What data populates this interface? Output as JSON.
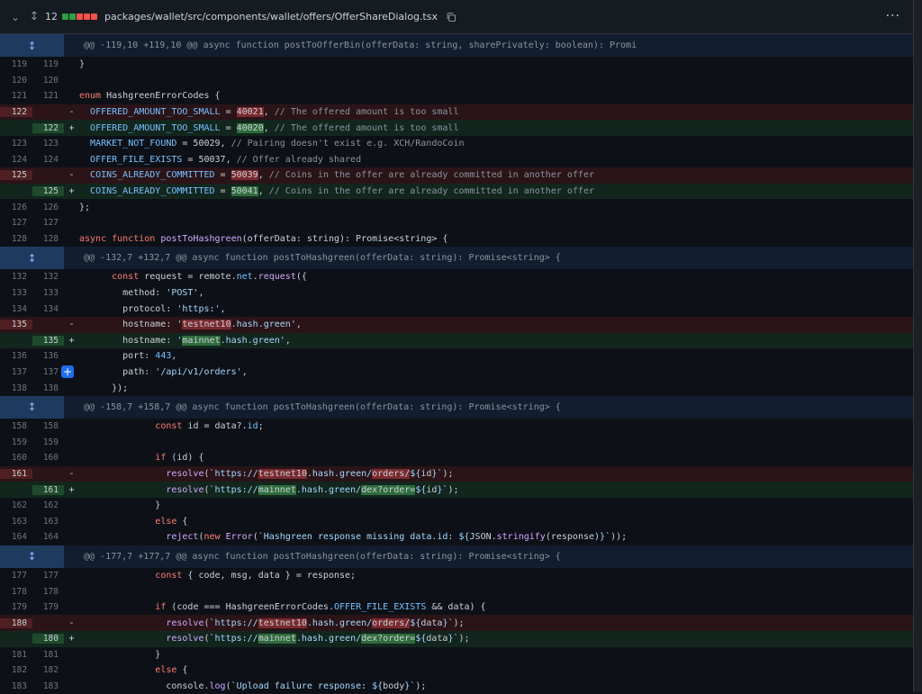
{
  "file": {
    "change_count": "12",
    "path": "packages/wallet/src/components/wallet/offers/OfferShareDialog.tsx",
    "diffstat_colors": [
      "#2ea043",
      "#2ea043",
      "#f85149",
      "#f85149",
      "#f85149"
    ],
    "icons": {
      "collapse": "chevron-down-icon",
      "expand": "expand-icon",
      "copy": "copy-icon",
      "more": "kebab-icon"
    }
  },
  "rows": [
    {
      "type": "hunk",
      "text": "@@ -119,10 +119,10 @@ async function postToOfferBin(offerData: string, sharePrivately: boolean): Promi"
    },
    {
      "type": "ctx",
      "old": "119",
      "new": "119",
      "tokens": [
        [
          "p",
          "}"
        ]
      ]
    },
    {
      "type": "ctx",
      "old": "120",
      "new": "120",
      "tokens": []
    },
    {
      "type": "ctx",
      "old": "121",
      "new": "121",
      "tokens": [
        [
          "kw",
          "enum "
        ],
        [
          "p",
          "HashgreenErrorCodes {"
        ]
      ]
    },
    {
      "type": "del",
      "old": "122",
      "new": "",
      "tokens": [
        [
          "p",
          "  "
        ],
        [
          "c",
          "OFFERED_AMOUNT_TOO_SMALL"
        ],
        [
          "p",
          " = "
        ],
        [
          "hd",
          "40021"
        ],
        [
          "p",
          ", "
        ],
        [
          "com",
          "// The offered amount is too small"
        ]
      ]
    },
    {
      "type": "add",
      "old": "",
      "new": "122",
      "tokens": [
        [
          "p",
          "  "
        ],
        [
          "c",
          "OFFERED_AMOUNT_TOO_SMALL"
        ],
        [
          "p",
          " = "
        ],
        [
          "ha",
          "40020"
        ],
        [
          "p",
          ", "
        ],
        [
          "com",
          "// The offered amount is too small"
        ]
      ]
    },
    {
      "type": "ctx",
      "old": "123",
      "new": "123",
      "tokens": [
        [
          "p",
          "  "
        ],
        [
          "c",
          "MARKET_NOT_FOUND"
        ],
        [
          "p",
          " = 50029, "
        ],
        [
          "com",
          "// Pairing doesn't exist e.g. XCH/RandoCoin"
        ]
      ]
    },
    {
      "type": "ctx",
      "old": "124",
      "new": "124",
      "tokens": [
        [
          "p",
          "  "
        ],
        [
          "c",
          "OFFER_FILE_EXISTS"
        ],
        [
          "p",
          " = 50037, "
        ],
        [
          "com",
          "// Offer already shared"
        ]
      ]
    },
    {
      "type": "del",
      "old": "125",
      "new": "",
      "tokens": [
        [
          "p",
          "  "
        ],
        [
          "c",
          "COINS_ALREADY_COMMITTED"
        ],
        [
          "p",
          " = "
        ],
        [
          "hd",
          "50039"
        ],
        [
          "p",
          ", "
        ],
        [
          "com",
          "// Coins in the offer are already committed in another offer"
        ]
      ]
    },
    {
      "type": "add",
      "old": "",
      "new": "125",
      "tokens": [
        [
          "p",
          "  "
        ],
        [
          "c",
          "COINS_ALREADY_COMMITTED"
        ],
        [
          "p",
          " = "
        ],
        [
          "ha",
          "50041"
        ],
        [
          "p",
          ", "
        ],
        [
          "com",
          "// Coins in the offer are already committed in another offer"
        ]
      ]
    },
    {
      "type": "ctx",
      "old": "126",
      "new": "126",
      "tokens": [
        [
          "p",
          "};"
        ]
      ]
    },
    {
      "type": "ctx",
      "old": "127",
      "new": "127",
      "tokens": []
    },
    {
      "type": "ctx",
      "old": "128",
      "new": "128",
      "tokens": [
        [
          "kw",
          "async function "
        ],
        [
          "fn",
          "postToHashgreen"
        ],
        [
          "p",
          "(offerData: string): Promise<string> {"
        ]
      ]
    },
    {
      "type": "hunk",
      "text": "@@ -132,7 +132,7 @@ async function postToHashgreen(offerData: string): Promise<string> {"
    },
    {
      "type": "ctx",
      "old": "132",
      "new": "132",
      "tokens": [
        [
          "p",
          "      "
        ],
        [
          "kw",
          "const "
        ],
        [
          "p",
          "request = remote."
        ],
        [
          "c",
          "net"
        ],
        [
          "p",
          "."
        ],
        [
          "fn",
          "request"
        ],
        [
          "p",
          "({"
        ]
      ]
    },
    {
      "type": "ctx",
      "old": "133",
      "new": "133",
      "tokens": [
        [
          "p",
          "        method: "
        ],
        [
          "s",
          "'POST'"
        ],
        [
          "p",
          ","
        ]
      ]
    },
    {
      "type": "ctx",
      "old": "134",
      "new": "134",
      "tokens": [
        [
          "p",
          "        protocol: "
        ],
        [
          "s",
          "'https:'"
        ],
        [
          "p",
          ","
        ]
      ]
    },
    {
      "type": "del",
      "old": "135",
      "new": "",
      "tokens": [
        [
          "p",
          "        hostname: "
        ],
        [
          "s",
          "'"
        ],
        [
          "hd",
          "testnet10"
        ],
        [
          "s",
          ".hash.green'"
        ],
        [
          "p",
          ","
        ]
      ]
    },
    {
      "type": "add",
      "old": "",
      "new": "135",
      "tokens": [
        [
          "p",
          "        hostname: "
        ],
        [
          "s",
          "'"
        ],
        [
          "ha",
          "mainnet"
        ],
        [
          "s",
          ".hash.green'"
        ],
        [
          "p",
          ","
        ]
      ]
    },
    {
      "type": "ctx",
      "old": "136",
      "new": "136",
      "tokens": [
        [
          "p",
          "        port: "
        ],
        [
          "n",
          "443"
        ],
        [
          "p",
          ","
        ]
      ]
    },
    {
      "type": "ctx",
      "old": "137",
      "new": "137",
      "plus": true,
      "tokens": [
        [
          "p",
          "        path: "
        ],
        [
          "s",
          "'/api/v1/orders'"
        ],
        [
          "p",
          ","
        ]
      ]
    },
    {
      "type": "ctx",
      "old": "138",
      "new": "138",
      "tokens": [
        [
          "p",
          "      });"
        ]
      ]
    },
    {
      "type": "hunk",
      "text": "@@ -158,7 +158,7 @@ async function postToHashgreen(offerData: string): Promise<string> {"
    },
    {
      "type": "ctx",
      "old": "158",
      "new": "158",
      "tokens": [
        [
          "p",
          "              "
        ],
        [
          "kw",
          "const "
        ],
        [
          "p",
          "id = data?."
        ],
        [
          "c",
          "id"
        ],
        [
          "p",
          ";"
        ]
      ]
    },
    {
      "type": "ctx",
      "old": "159",
      "new": "159",
      "tokens": []
    },
    {
      "type": "ctx",
      "old": "160",
      "new": "160",
      "tokens": [
        [
          "p",
          "              "
        ],
        [
          "kw",
          "if "
        ],
        [
          "p",
          "(id) {"
        ]
      ]
    },
    {
      "type": "del",
      "old": "161",
      "new": "",
      "tokens": [
        [
          "p",
          "                "
        ],
        [
          "fn",
          "resolve"
        ],
        [
          "p",
          "("
        ],
        [
          "s",
          "`https://"
        ],
        [
          "hd",
          "testnet10"
        ],
        [
          "s",
          ".hash.green/"
        ],
        [
          "hd",
          "orders/"
        ],
        [
          "s",
          "${"
        ],
        [
          "p",
          "id"
        ],
        [
          "s",
          "}`"
        ],
        [
          "p",
          ");"
        ]
      ]
    },
    {
      "type": "add",
      "old": "",
      "new": "161",
      "tokens": [
        [
          "p",
          "                "
        ],
        [
          "fn",
          "resolve"
        ],
        [
          "p",
          "("
        ],
        [
          "s",
          "`https://"
        ],
        [
          "ha",
          "mainnet"
        ],
        [
          "s",
          ".hash.green/"
        ],
        [
          "ha",
          "dex?order="
        ],
        [
          "s",
          "${"
        ],
        [
          "p",
          "id"
        ],
        [
          "s",
          "}`"
        ],
        [
          "p",
          ");"
        ]
      ]
    },
    {
      "type": "ctx",
      "old": "162",
      "new": "162",
      "tokens": [
        [
          "p",
          "              }"
        ]
      ]
    },
    {
      "type": "ctx",
      "old": "163",
      "new": "163",
      "tokens": [
        [
          "p",
          "              "
        ],
        [
          "kw",
          "else "
        ],
        [
          "p",
          "{"
        ]
      ]
    },
    {
      "type": "ctx",
      "old": "164",
      "new": "164",
      "tokens": [
        [
          "p",
          "                "
        ],
        [
          "fn",
          "reject"
        ],
        [
          "p",
          "("
        ],
        [
          "kw",
          "new "
        ],
        [
          "fn",
          "Error"
        ],
        [
          "p",
          "("
        ],
        [
          "s",
          "`Hashgreen response missing data.id: ${"
        ],
        [
          "p",
          "JSON."
        ],
        [
          "fn",
          "stringify"
        ],
        [
          "p",
          "(response)"
        ],
        [
          "s",
          "}`"
        ],
        [
          "p",
          "));"
        ]
      ]
    },
    {
      "type": "hunk",
      "text": "@@ -177,7 +177,7 @@ async function postToHashgreen(offerData: string): Promise<string> {"
    },
    {
      "type": "ctx",
      "old": "177",
      "new": "177",
      "tokens": [
        [
          "p",
          "              "
        ],
        [
          "kw",
          "const "
        ],
        [
          "p",
          "{ code, msg, data } = response;"
        ]
      ]
    },
    {
      "type": "ctx",
      "old": "178",
      "new": "178",
      "tokens": []
    },
    {
      "type": "ctx",
      "old": "179",
      "new": "179",
      "tokens": [
        [
          "p",
          "              "
        ],
        [
          "kw",
          "if "
        ],
        [
          "p",
          "(code === HashgreenErrorCodes."
        ],
        [
          "c",
          "OFFER_FILE_EXISTS"
        ],
        [
          "p",
          " && data) {"
        ]
      ]
    },
    {
      "type": "del",
      "old": "180",
      "new": "",
      "tokens": [
        [
          "p",
          "                "
        ],
        [
          "fn",
          "resolve"
        ],
        [
          "p",
          "("
        ],
        [
          "s",
          "`https://"
        ],
        [
          "hd",
          "testnet10"
        ],
        [
          "s",
          ".hash.green/"
        ],
        [
          "hd",
          "orders/"
        ],
        [
          "s",
          "${"
        ],
        [
          "p",
          "data"
        ],
        [
          "s",
          "}`"
        ],
        [
          "p",
          ");"
        ]
      ]
    },
    {
      "type": "add",
      "old": "",
      "new": "180",
      "tokens": [
        [
          "p",
          "                "
        ],
        [
          "fn",
          "resolve"
        ],
        [
          "p",
          "("
        ],
        [
          "s",
          "`https://"
        ],
        [
          "ha",
          "mainnet"
        ],
        [
          "s",
          ".hash.green/"
        ],
        [
          "ha",
          "dex?order="
        ],
        [
          "s",
          "${"
        ],
        [
          "p",
          "data"
        ],
        [
          "s",
          "}`"
        ],
        [
          "p",
          ");"
        ]
      ]
    },
    {
      "type": "ctx",
      "old": "181",
      "new": "181",
      "tokens": [
        [
          "p",
          "              }"
        ]
      ]
    },
    {
      "type": "ctx",
      "old": "182",
      "new": "182",
      "tokens": [
        [
          "p",
          "              "
        ],
        [
          "kw",
          "else "
        ],
        [
          "p",
          "{"
        ]
      ]
    },
    {
      "type": "ctx",
      "old": "183",
      "new": "183",
      "tokens": [
        [
          "p",
          "                console."
        ],
        [
          "fn",
          "log"
        ],
        [
          "p",
          "("
        ],
        [
          "s",
          "`Upload failure response: ${"
        ],
        [
          "p",
          "body"
        ],
        [
          "s",
          "}`"
        ],
        [
          "p",
          ");"
        ]
      ]
    }
  ]
}
